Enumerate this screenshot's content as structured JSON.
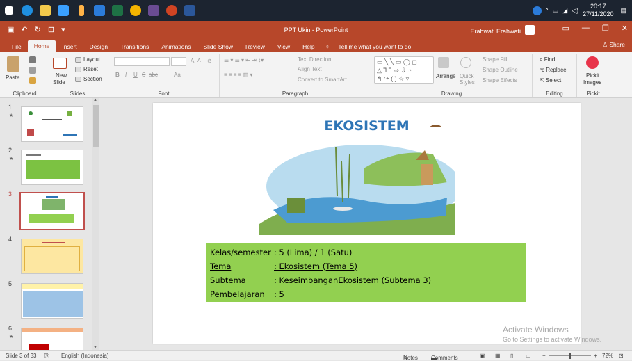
{
  "taskbar": {
    "apps": [
      "start",
      "edge",
      "file-explorer",
      "store",
      "winamp",
      "photos",
      "excel",
      "chrome",
      "media",
      "powerpoint",
      "word"
    ],
    "clock_time": "20:17",
    "clock_date": "27/11/2020"
  },
  "window": {
    "title": "PPT Ukin  -  PowerPoint",
    "user": "Erahwati Erahwati"
  },
  "tabs": [
    "File",
    "Home",
    "Insert",
    "Design",
    "Transitions",
    "Animations",
    "Slide Show",
    "Review",
    "View",
    "Help"
  ],
  "active_tab": "Home",
  "tell_me": "Tell me what you want to do",
  "share": "Share",
  "ribbon": {
    "clipboard": {
      "paste": "Paste",
      "label": "Clipboard"
    },
    "slides": {
      "new_slide": "New",
      "new_slide2": "Slide",
      "layout": "Layout",
      "reset": "Reset",
      "section": "Section",
      "label": "Slides"
    },
    "font": {
      "label": "Font",
      "bold": "B",
      "italic": "I",
      "underline": "U",
      "strike": "S",
      "abc": "abc",
      "aa": "Aa",
      "grow": "A",
      "shrink": "A"
    },
    "paragraph": {
      "label": "Paragraph",
      "text_direction": "Text Direction",
      "align_text": "Align Text",
      "convert": "Convert to SmartArt"
    },
    "drawing": {
      "label": "Drawing",
      "arrange": "Arrange",
      "quick_styles": "Quick",
      "quick_styles2": "Styles",
      "shape_fill": "Shape Fill",
      "shape_outline": "Shape Outline",
      "shape_effects": "Shape Effects"
    },
    "editing": {
      "label": "Editing",
      "find": "Find",
      "replace": "Replace",
      "select": "Select"
    },
    "pickit": {
      "label": "Pickit",
      "images": "Pickit",
      "images2": "Images"
    }
  },
  "thumbnails": [
    {
      "num": "1",
      "star": "★"
    },
    {
      "num": "2",
      "star": "★"
    },
    {
      "num": "3",
      "star": ""
    },
    {
      "num": "4",
      "star": ""
    },
    {
      "num": "5",
      "star": ""
    },
    {
      "num": "6",
      "star": "★"
    }
  ],
  "slide": {
    "title": "EKOSISTEM",
    "rows": [
      {
        "key": "Kelas/semester",
        "value": ": 5 (Lima) / 1 (Satu)"
      },
      {
        "key": "Tema",
        "value": ": Ekosistem (Tema 5)"
      },
      {
        "key": "Subtema",
        "value": ": KeseimbanganEkosistem  (Subtema 3)"
      },
      {
        "key": "Pembelajaran",
        "value": ": 5"
      }
    ]
  },
  "watermark": {
    "line1": "Activate Windows",
    "line2": "Go to Settings to activate Windows."
  },
  "status": {
    "slide_info": "Slide 3 of 33",
    "language": "English (Indonesia)",
    "notes": "Notes",
    "comments": "Comments",
    "zoom": "72%",
    "minus": "−",
    "plus": "+"
  },
  "colors": {
    "ppt_red": "#b7472a",
    "box_green": "#92d050",
    "title_blue": "#2e75b6"
  }
}
